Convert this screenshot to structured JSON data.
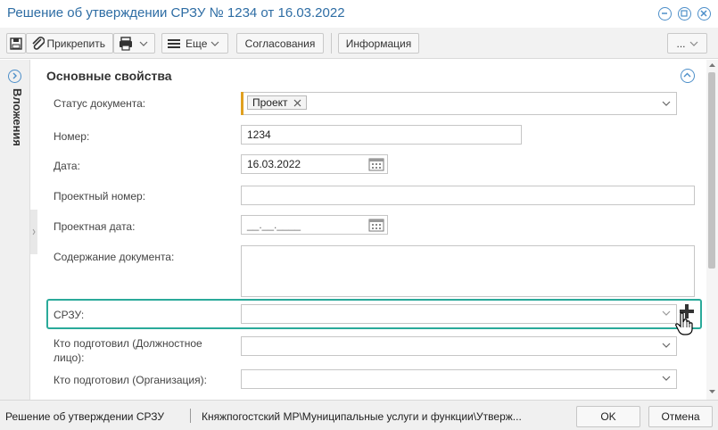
{
  "window": {
    "title": "Решение об утверждении СРЗУ № 1234 от 16.03.2022"
  },
  "toolbar": {
    "attach_label": "Прикрепить",
    "more_label": "Еще",
    "approvals_label": "Согласования",
    "info_label": "Информация",
    "overflow_label": "..."
  },
  "sidebar": {
    "attachments_label": "Вложения"
  },
  "section": {
    "title": "Основные свойства"
  },
  "form": {
    "status_label": "Статус документа:",
    "status_value": "Проект",
    "number_label": "Номер:",
    "number_value": "1234",
    "date_label": "Дата:",
    "date_value": "16.03.2022",
    "project_number_label": "Проектный номер:",
    "project_number_value": "",
    "project_date_label": "Проектная дата:",
    "project_date_value": "__.__.____",
    "content_label": "Содержание документа:",
    "content_value": "",
    "srzu_label": "СРЗУ:",
    "srzu_value": "",
    "prepared_official_label": "Кто подготовил (Должностное лицо):",
    "prepared_org_label": "Кто подготовил (Организация):"
  },
  "footer": {
    "doc_type": "Решение об утверждении СРЗУ",
    "path": "Княжпогостский МР\\Муниципальные услуги и функции\\Утверж...",
    "ok_label": "OK",
    "cancel_label": "Отмена"
  },
  "colors": {
    "title_blue": "#2e6da4",
    "accent_teal": "#2aaa9a",
    "required_orange": "#e0a020"
  }
}
